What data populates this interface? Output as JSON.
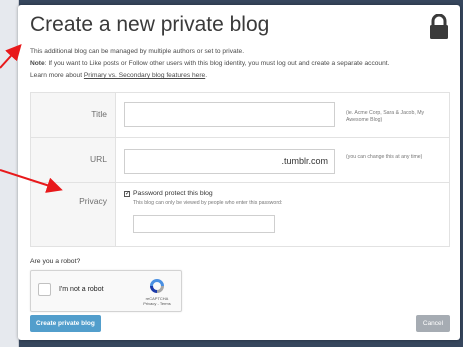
{
  "dialog": {
    "title": "Create a new private blog",
    "intro": "This additional blog can be managed by multiple authors or set to private.",
    "note_label": "Note",
    "note_text": ": If you want to Like posts or Follow other users with this blog identity, you must log out and create a separate account.",
    "learn_prefix": "Learn more about ",
    "learn_link": "Primary vs. Secondary blog features here",
    "learn_suffix": "."
  },
  "form": {
    "title_label": "Title",
    "title_value": "",
    "title_hint": "(ie. Acme Corp, Sara & Jacob, My Awesome Blog)",
    "url_label": "URL",
    "url_value": "",
    "url_suffix": ".tumblr.com",
    "url_hint": "(you can change this at any time)",
    "privacy_label": "Privacy",
    "password_checkbox_label": "Password protect this blog",
    "password_checked": true,
    "password_sub": "This blog can only be viewed by people who enter this password:",
    "password_value": ""
  },
  "captcha": {
    "question": "Are you a robot?",
    "label": "I'm not a robot",
    "brand": "reCAPTCHA",
    "links": "Privacy - Terms"
  },
  "buttons": {
    "create": "Create private blog",
    "cancel": "Cancel"
  },
  "colors": {
    "backdrop": "#36465d",
    "primary": "#529ecc",
    "cancel": "#a6acb3",
    "annotation_arrow": "#e8191b"
  },
  "icons": [
    "lock-icon",
    "checkmark-icon",
    "recaptcha-icon",
    "annotation-arrow"
  ]
}
